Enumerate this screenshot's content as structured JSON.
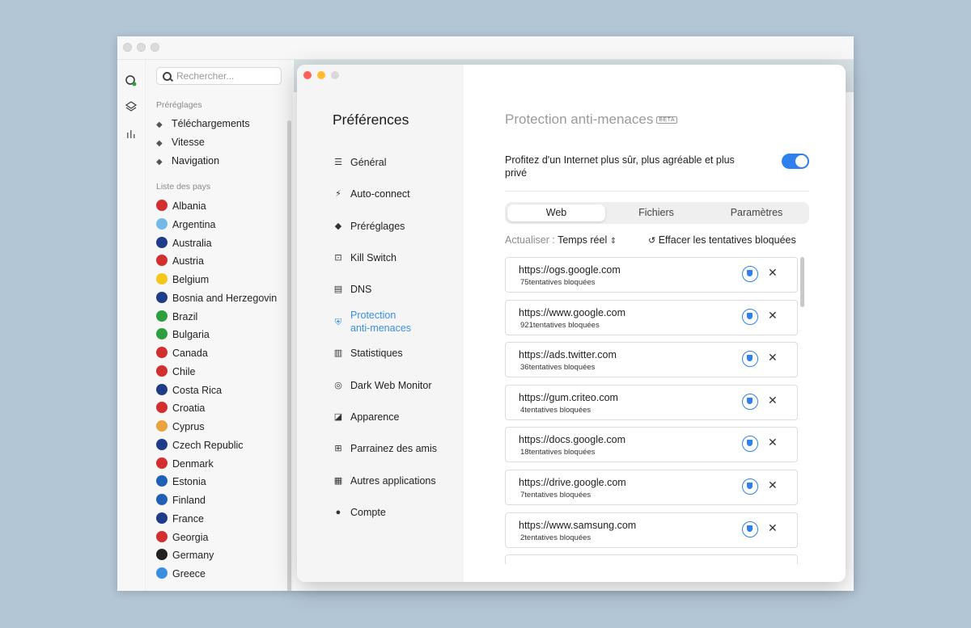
{
  "sidebar": {
    "search_placeholder": "Rechercher...",
    "presets_heading": "Préréglages",
    "presets": [
      {
        "label": "Téléchargements"
      },
      {
        "label": "Vitesse"
      },
      {
        "label": "Navigation"
      }
    ],
    "countries_heading": "Liste des pays",
    "countries": [
      {
        "name": "Albania",
        "flag_color": "#d32f2f"
      },
      {
        "name": "Argentina",
        "flag_color": "#74b9e8"
      },
      {
        "name": "Australia",
        "flag_color": "#1f3c8a"
      },
      {
        "name": "Austria",
        "flag_color": "#d32f2f"
      },
      {
        "name": "Belgium",
        "flag_color": "#f5c518"
      },
      {
        "name": "Bosnia and Herzegovin",
        "flag_color": "#1f3c8a"
      },
      {
        "name": "Brazil",
        "flag_color": "#2e9e3e"
      },
      {
        "name": "Bulgaria",
        "flag_color": "#2e9e3e"
      },
      {
        "name": "Canada",
        "flag_color": "#d32f2f"
      },
      {
        "name": "Chile",
        "flag_color": "#d32f2f"
      },
      {
        "name": "Costa Rica",
        "flag_color": "#1f3c8a"
      },
      {
        "name": "Croatia",
        "flag_color": "#d32f2f"
      },
      {
        "name": "Cyprus",
        "flag_color": "#e8a33d"
      },
      {
        "name": "Czech Republic",
        "flag_color": "#1f3c8a"
      },
      {
        "name": "Denmark",
        "flag_color": "#d32f2f"
      },
      {
        "name": "Estonia",
        "flag_color": "#1f5fb5"
      },
      {
        "name": "Finland",
        "flag_color": "#1f5fb5"
      },
      {
        "name": "France",
        "flag_color": "#1f3c8a"
      },
      {
        "name": "Georgia",
        "flag_color": "#d32f2f"
      },
      {
        "name": "Germany",
        "flag_color": "#222222"
      },
      {
        "name": "Greece",
        "flag_color": "#3a8ee0"
      }
    ]
  },
  "prefs": {
    "title": "Préférences",
    "nav": [
      {
        "label": "Général",
        "icon": "sliders-icon"
      },
      {
        "label": "Auto-connect",
        "icon": "auto-connect-icon"
      },
      {
        "label": "Préréglages",
        "icon": "layers-icon"
      },
      {
        "label": "Kill Switch",
        "icon": "kill-switch-icon"
      },
      {
        "label": "DNS",
        "icon": "dns-icon"
      },
      {
        "label": "Protection",
        "label2": "anti-menaces",
        "icon": "shield-icon"
      },
      {
        "label": "Statistiques",
        "icon": "stats-icon"
      },
      {
        "label": "Dark Web Monitor",
        "icon": "radar-icon"
      },
      {
        "label": "Apparence",
        "icon": "appearance-icon"
      },
      {
        "label": "Parrainez des amis",
        "icon": "gift-icon"
      },
      {
        "label": "Autres applications",
        "icon": "apps-icon"
      },
      {
        "label": "Compte",
        "icon": "account-icon"
      }
    ],
    "active_color": "#3a8ee0"
  },
  "main": {
    "title": "Protection anti-menaces",
    "beta": "BETA",
    "description": "Profitez d'un Internet plus sûr, plus agréable et plus privé",
    "toggle_on": true,
    "tabs": [
      "Web",
      "Fichiers",
      "Paramètres"
    ],
    "refresh_label": "Actualiser :",
    "refresh_value": "Temps réel",
    "clear_label": "Effacer les tentatives bloquées",
    "rows": [
      {
        "url": "https://ogs.google.com",
        "count": "75tentatives bloquées"
      },
      {
        "url": "https://www.google.com",
        "count": "921tentatives bloquées"
      },
      {
        "url": "https://ads.twitter.com",
        "count": "36tentatives bloquées"
      },
      {
        "url": "https://gum.criteo.com",
        "count": "4tentatives bloquées"
      },
      {
        "url": "https://docs.google.com",
        "count": "18tentatives bloquées"
      },
      {
        "url": "https://drive.google.com",
        "count": "7tentatives bloquées"
      },
      {
        "url": "https://www.samsung.com",
        "count": "2tentatives bloquées"
      }
    ]
  }
}
